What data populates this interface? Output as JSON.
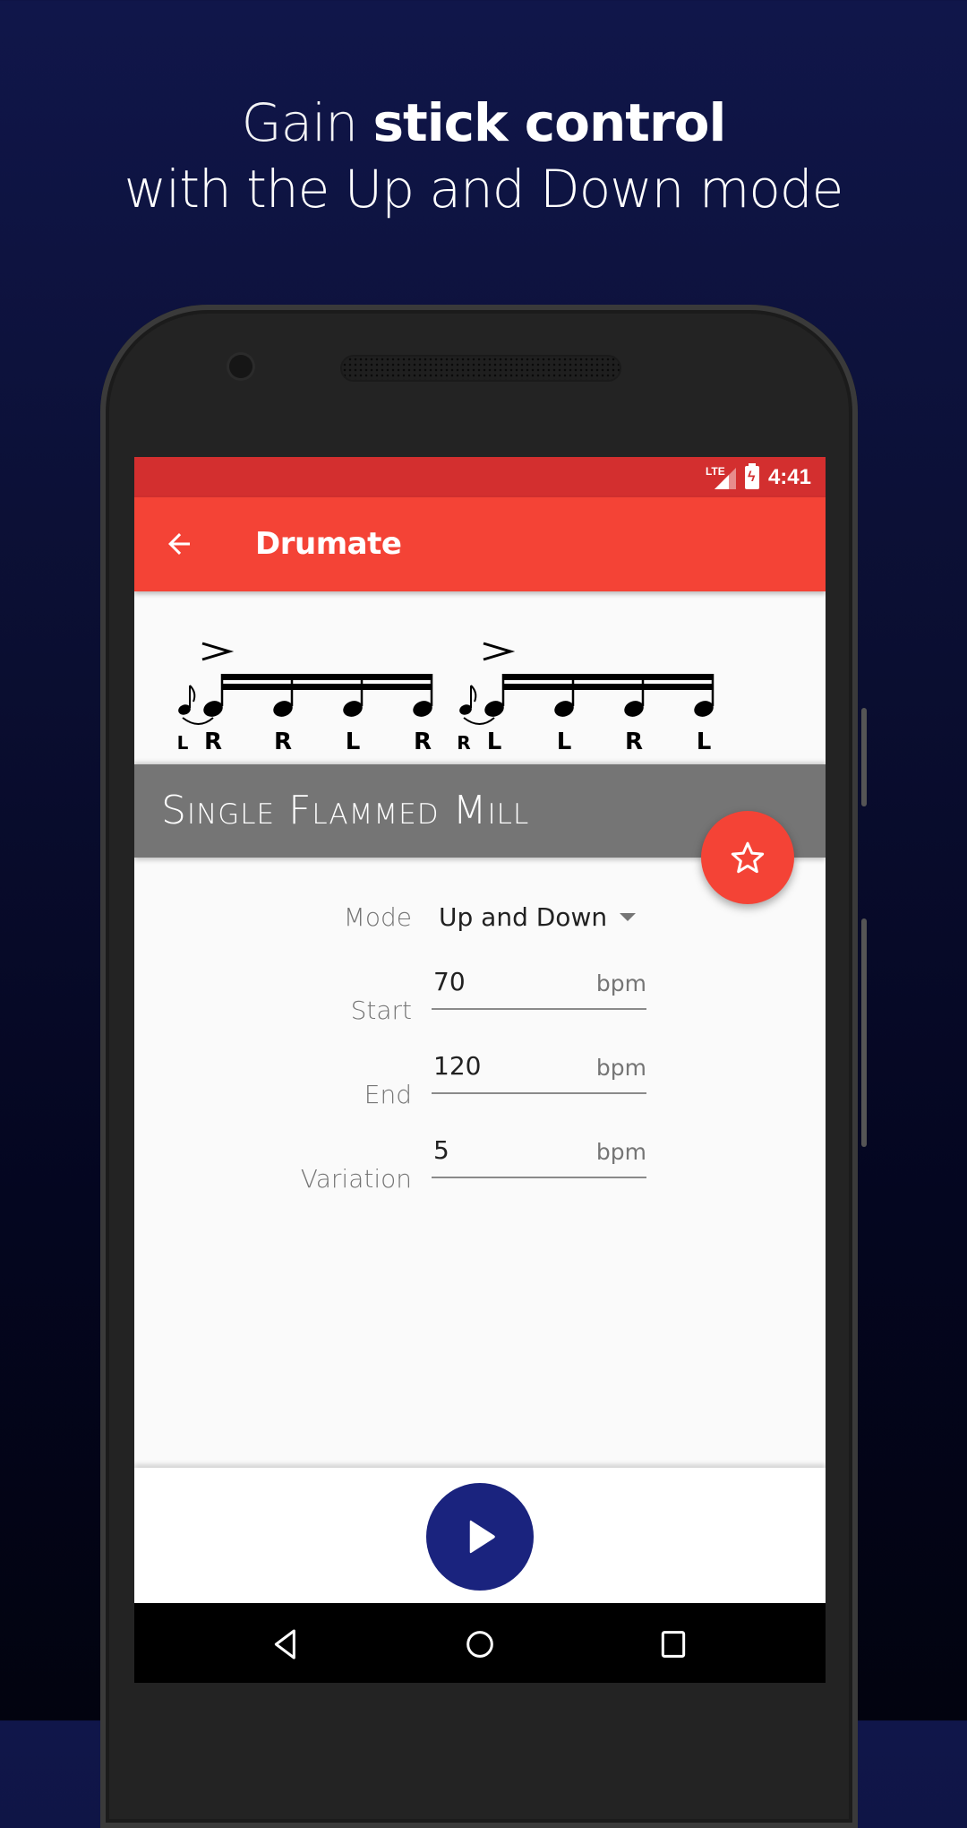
{
  "headline": {
    "line1_prefix": "Gain ",
    "line1_bold": "stick control",
    "line2": "with the Up and Down mode"
  },
  "status_bar": {
    "network": "LTE",
    "battery_icon": "battery-charging-icon",
    "time": "4:41"
  },
  "toolbar": {
    "back_icon": "arrow-back-icon",
    "title": "Drumate"
  },
  "notation": {
    "groups": [
      {
        "grace_sticking": "L",
        "accent_on_first": true,
        "stickings": [
          "R",
          "R",
          "L",
          "R"
        ]
      },
      {
        "grace_sticking": "R",
        "accent_on_first": true,
        "stickings": [
          "L",
          "L",
          "R",
          "L"
        ]
      }
    ]
  },
  "rudiment": {
    "title": "Single Flammed Mill",
    "favorite_icon": "star-outline-icon"
  },
  "form": {
    "mode": {
      "label": "Mode",
      "value": "Up and Down"
    },
    "start": {
      "label": "Start",
      "value": "70",
      "unit": "bpm"
    },
    "end": {
      "label": "End",
      "value": "120",
      "unit": "bpm"
    },
    "variation": {
      "label": "Variation",
      "value": "5",
      "unit": "bpm"
    }
  },
  "player": {
    "play_icon": "play-icon"
  },
  "navigation": {
    "back": "nav-back-icon",
    "home": "nav-home-icon",
    "recents": "nav-recents-icon"
  },
  "colors": {
    "primary": "#f44336",
    "primary_dark": "#d32f2f",
    "title_band": "#757575",
    "play_button": "#1a237e"
  }
}
